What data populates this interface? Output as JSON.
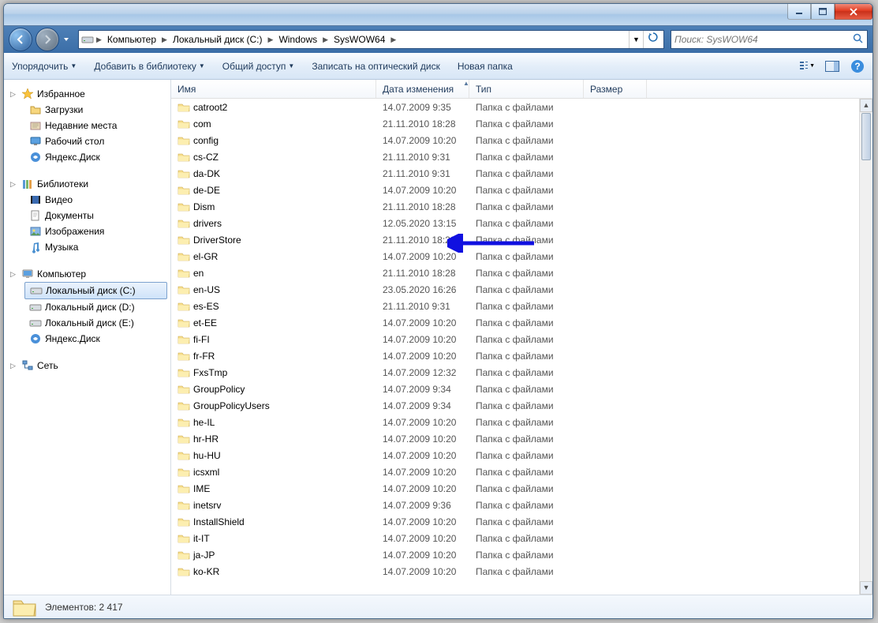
{
  "win": {
    "min": "─",
    "max": "❐",
    "close": "✕"
  },
  "breadcrumbs": [
    {
      "label": "Компьютер"
    },
    {
      "label": "Локальный диск (C:)"
    },
    {
      "label": "Windows"
    },
    {
      "label": "SysWOW64"
    }
  ],
  "search": {
    "placeholder": "Поиск: SysWOW64"
  },
  "toolbar": {
    "organize": "Упорядочить",
    "library": "Добавить в библиотеку",
    "share": "Общий доступ",
    "burn": "Записать на оптический диск",
    "newfolder": "Новая папка"
  },
  "columns": {
    "name": "Имя",
    "date": "Дата изменения",
    "type": "Тип",
    "size": "Размер"
  },
  "sidebar": {
    "favorites": {
      "label": "Избранное",
      "items": [
        {
          "label": "Загрузки"
        },
        {
          "label": "Недавние места"
        },
        {
          "label": "Рабочий стол"
        },
        {
          "label": "Яндекс.Диск"
        }
      ]
    },
    "libraries": {
      "label": "Библиотеки",
      "items": [
        {
          "label": "Видео"
        },
        {
          "label": "Документы"
        },
        {
          "label": "Изображения"
        },
        {
          "label": "Музыка"
        }
      ]
    },
    "computer": {
      "label": "Компьютер",
      "items": [
        {
          "label": "Локальный диск (C:)",
          "selected": true
        },
        {
          "label": "Локальный диск (D:)"
        },
        {
          "label": "Локальный диск (E:)"
        },
        {
          "label": "Яндекс.Диск"
        }
      ]
    },
    "network": {
      "label": "Сеть"
    }
  },
  "files": [
    {
      "name": "catroot2",
      "date": "14.07.2009 9:35",
      "type": "Папка с файлами"
    },
    {
      "name": "com",
      "date": "21.11.2010 18:28",
      "type": "Папка с файлами"
    },
    {
      "name": "config",
      "date": "14.07.2009 10:20",
      "type": "Папка с файлами"
    },
    {
      "name": "cs-CZ",
      "date": "21.11.2010 9:31",
      "type": "Папка с файлами"
    },
    {
      "name": "da-DK",
      "date": "21.11.2010 9:31",
      "type": "Папка с файлами"
    },
    {
      "name": "de-DE",
      "date": "14.07.2009 10:20",
      "type": "Папка с файлами"
    },
    {
      "name": "Dism",
      "date": "21.11.2010 18:28",
      "type": "Папка с файлами"
    },
    {
      "name": "drivers",
      "date": "12.05.2020 13:15",
      "type": "Папка с файлами"
    },
    {
      "name": "DriverStore",
      "date": "21.11.2010 18:28",
      "type": "Папка с файлами"
    },
    {
      "name": "el-GR",
      "date": "14.07.2009 10:20",
      "type": "Папка с файлами"
    },
    {
      "name": "en",
      "date": "21.11.2010 18:28",
      "type": "Папка с файлами"
    },
    {
      "name": "en-US",
      "date": "23.05.2020 16:26",
      "type": "Папка с файлами"
    },
    {
      "name": "es-ES",
      "date": "21.11.2010 9:31",
      "type": "Папка с файлами"
    },
    {
      "name": "et-EE",
      "date": "14.07.2009 10:20",
      "type": "Папка с файлами"
    },
    {
      "name": "fi-FI",
      "date": "14.07.2009 10:20",
      "type": "Папка с файлами"
    },
    {
      "name": "fr-FR",
      "date": "14.07.2009 10:20",
      "type": "Папка с файлами"
    },
    {
      "name": "FxsTmp",
      "date": "14.07.2009 12:32",
      "type": "Папка с файлами"
    },
    {
      "name": "GroupPolicy",
      "date": "14.07.2009 9:34",
      "type": "Папка с файлами"
    },
    {
      "name": "GroupPolicyUsers",
      "date": "14.07.2009 9:34",
      "type": "Папка с файлами"
    },
    {
      "name": "he-IL",
      "date": "14.07.2009 10:20",
      "type": "Папка с файлами"
    },
    {
      "name": "hr-HR",
      "date": "14.07.2009 10:20",
      "type": "Папка с файлами"
    },
    {
      "name": "hu-HU",
      "date": "14.07.2009 10:20",
      "type": "Папка с файлами"
    },
    {
      "name": "icsxml",
      "date": "14.07.2009 10:20",
      "type": "Папка с файлами"
    },
    {
      "name": "IME",
      "date": "14.07.2009 10:20",
      "type": "Папка с файлами"
    },
    {
      "name": "inetsrv",
      "date": "14.07.2009 9:36",
      "type": "Папка с файлами"
    },
    {
      "name": "InstallShield",
      "date": "14.07.2009 10:20",
      "type": "Папка с файлами"
    },
    {
      "name": "it-IT",
      "date": "14.07.2009 10:20",
      "type": "Папка с файлами"
    },
    {
      "name": "ja-JP",
      "date": "14.07.2009 10:20",
      "type": "Папка с файлами"
    },
    {
      "name": "ko-KR",
      "date": "14.07.2009 10:20",
      "type": "Папка с файлами"
    }
  ],
  "status": {
    "count_label": "Элементов: 2 417"
  }
}
